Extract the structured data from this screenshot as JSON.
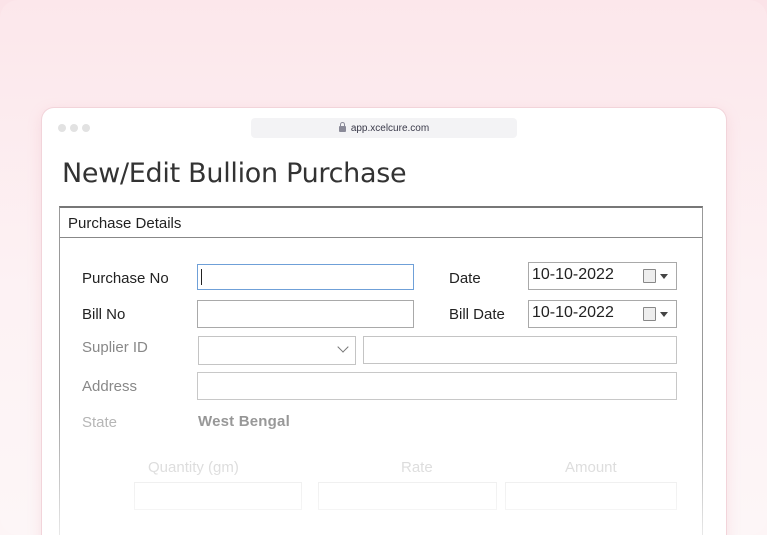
{
  "browser": {
    "url": "app.xcelcure.com"
  },
  "page": {
    "title": "New/Edit Bullion Purchase"
  },
  "group": {
    "title": "Purchase Details"
  },
  "form": {
    "purchase_no_label": "Purchase No",
    "purchase_no_value": "",
    "date_label": "Date",
    "date_value": "10-10-2022",
    "bill_no_label": "Bill No",
    "bill_no_value": "",
    "bill_date_label": "Bill Date",
    "bill_date_value": "10-10-2022",
    "supplier_id_label": "Suplier ID",
    "supplier_id_value": "",
    "supplier_name_value": "",
    "address_label": "Address",
    "address_value": "",
    "state_label": "State",
    "state_value": "West Bengal",
    "quantity_label": "Quantity (gm)",
    "rate_label": "Rate",
    "amount_label": "Amount"
  },
  "colors": {
    "background": "#fce7eb",
    "active_border": "#6fa0d8"
  }
}
